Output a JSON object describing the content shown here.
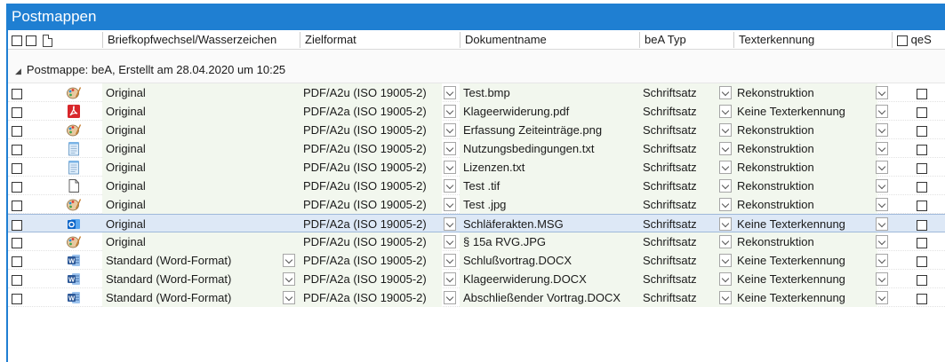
{
  "window": {
    "title": "Postmappen"
  },
  "columns": {
    "briefkopf": "Briefkopfwechsel/Wasserzeichen",
    "zielformat": "Zielformat",
    "dokumentname": "Dokumentname",
    "bea_typ": "beA Typ",
    "texterkennung": "Texterkennung",
    "qes": "qeS"
  },
  "group": {
    "label": "Postmappe: beA, Erstellt am 28.04.2020 um 10:25"
  },
  "rows": [
    {
      "icon": "paint-icon",
      "briefkopf": "Original",
      "briefkopf_dropdown": false,
      "zielformat": "PDF/A2u (ISO 19005-2)",
      "dokumentname": "Test.bmp",
      "bea_typ": "Schriftsatz",
      "texterkennung": "Rekonstruktion",
      "selected": false
    },
    {
      "icon": "pdf-icon",
      "briefkopf": "Original",
      "briefkopf_dropdown": false,
      "zielformat": "PDF/A2a (ISO 19005-2)",
      "dokumentname": "Klageerwiderung.pdf",
      "bea_typ": "Schriftsatz",
      "texterkennung": "Keine Texterkennung",
      "selected": false
    },
    {
      "icon": "paint-icon",
      "briefkopf": "Original",
      "briefkopf_dropdown": false,
      "zielformat": "PDF/A2u (ISO 19005-2)",
      "dokumentname": "Erfassung Zeiteinträge.png",
      "bea_typ": "Schriftsatz",
      "texterkennung": "Rekonstruktion",
      "selected": false
    },
    {
      "icon": "notepad-icon",
      "briefkopf": "Original",
      "briefkopf_dropdown": false,
      "zielformat": "PDF/A2u (ISO 19005-2)",
      "dokumentname": "Nutzungsbedingungen.txt",
      "bea_typ": "Schriftsatz",
      "texterkennung": "Rekonstruktion",
      "selected": false
    },
    {
      "icon": "notepad-icon",
      "briefkopf": "Original",
      "briefkopf_dropdown": false,
      "zielformat": "PDF/A2u (ISO 19005-2)",
      "dokumentname": "Lizenzen.txt",
      "bea_typ": "Schriftsatz",
      "texterkennung": "Rekonstruktion",
      "selected": false
    },
    {
      "icon": "blank-file-icon",
      "briefkopf": "Original",
      "briefkopf_dropdown": false,
      "zielformat": "PDF/A2u (ISO 19005-2)",
      "dokumentname": "Test .tif",
      "bea_typ": "Schriftsatz",
      "texterkennung": "Rekonstruktion",
      "selected": false
    },
    {
      "icon": "paint-icon",
      "briefkopf": "Original",
      "briefkopf_dropdown": false,
      "zielformat": "PDF/A2u (ISO 19005-2)",
      "dokumentname": "Test .jpg",
      "bea_typ": "Schriftsatz",
      "texterkennung": "Rekonstruktion",
      "selected": false
    },
    {
      "icon": "outlook-icon",
      "briefkopf": "Original",
      "briefkopf_dropdown": false,
      "zielformat": "PDF/A2a (ISO 19005-2)",
      "dokumentname": "Schläferakten.MSG",
      "bea_typ": "Schriftsatz",
      "texterkennung": "Keine Texterkennung",
      "selected": true
    },
    {
      "icon": "paint-icon",
      "briefkopf": "Original",
      "briefkopf_dropdown": false,
      "zielformat": "PDF/A2u (ISO 19005-2)",
      "dokumentname": "§ 15a RVG.JPG",
      "bea_typ": "Schriftsatz",
      "texterkennung": "Rekonstruktion",
      "selected": false
    },
    {
      "icon": "word-icon",
      "briefkopf": "Standard (Word-Format)",
      "briefkopf_dropdown": true,
      "zielformat": "PDF/A2a (ISO 19005-2)",
      "dokumentname": "Schlußvortrag.DOCX",
      "bea_typ": "Schriftsatz",
      "texterkennung": "Keine Texterkennung",
      "selected": false
    },
    {
      "icon": "word-icon",
      "briefkopf": "Standard (Word-Format)",
      "briefkopf_dropdown": true,
      "zielformat": "PDF/A2a (ISO 19005-2)",
      "dokumentname": "Klageerwiderung.DOCX",
      "bea_typ": "Schriftsatz",
      "texterkennung": "Keine Texterkennung",
      "selected": false
    },
    {
      "icon": "word-icon",
      "briefkopf": "Standard (Word-Format)",
      "briefkopf_dropdown": true,
      "zielformat": "PDF/A2a (ISO 19005-2)",
      "dokumentname": "Abschließender Vortrag.DOCX",
      "bea_typ": "Schriftsatz",
      "texterkennung": "Keine Texterkennung",
      "selected": false
    }
  ],
  "colors": {
    "accent": "#1f7fd2",
    "row_tint": "#f2f7ee",
    "selected": "#dde8f6",
    "pdf_red": "#d8262b",
    "word_blue": "#2b5797",
    "outlook_blue": "#0a64c8"
  }
}
